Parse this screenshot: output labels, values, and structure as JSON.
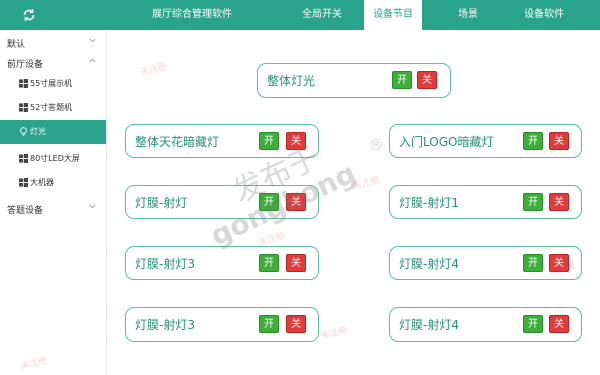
{
  "header": {
    "refresh_icon": "refresh-icon",
    "app_title": "展厅综合管理软件",
    "tabs": [
      {
        "label": "全局开关",
        "active": false
      },
      {
        "label": "设备节目",
        "active": true
      },
      {
        "label": "场景",
        "active": false
      },
      {
        "label": "设备软件",
        "active": false
      }
    ]
  },
  "sidebar": {
    "groups": [
      {
        "label": "默认",
        "expanded": false
      },
      {
        "label": "前厅设备",
        "expanded": true
      },
      {
        "label": "答题设备",
        "expanded": false
      }
    ],
    "items": [
      {
        "label": "55寸展示机",
        "icon": "windows-icon"
      },
      {
        "label": "52寸答题机",
        "icon": "windows-icon"
      },
      {
        "label": "灯光",
        "icon": "bulb-icon",
        "active": true
      },
      {
        "label": "80寸LED大屏",
        "icon": "windows-icon"
      },
      {
        "label": "大机器",
        "icon": "windows-icon"
      }
    ]
  },
  "main": {
    "lights": [
      {
        "name": "整体灯光",
        "on_label": "开",
        "off_label": "关"
      },
      {
        "name": "整体天花暗藏灯",
        "on_label": "开",
        "off_label": "关"
      },
      {
        "name": "入门LOGO暗藏灯",
        "on_label": "开",
        "off_label": "关"
      },
      {
        "name": "灯膜-射灯",
        "on_label": "开",
        "off_label": "关"
      },
      {
        "name": "灯膜-射灯1",
        "on_label": "开",
        "off_label": "关"
      },
      {
        "name": "灯膜-射灯3",
        "on_label": "开",
        "off_label": "关"
      },
      {
        "name": "灯膜-射灯4",
        "on_label": "开",
        "off_label": "关"
      },
      {
        "name": "灯膜-射灯3",
        "on_label": "开",
        "off_label": "关"
      },
      {
        "name": "灯膜-射灯4",
        "on_label": "开",
        "off_label": "关"
      }
    ]
  },
  "watermark": {
    "big_text": "发布于",
    "site_text": "gongkong",
    "registered": "®",
    "small_text": "未注册"
  },
  "colors": {
    "accent": "#2aa38b",
    "on_button": "#3dae39",
    "off_button": "#e23b3b"
  }
}
